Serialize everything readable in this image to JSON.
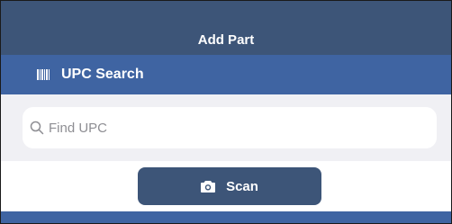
{
  "nav": {
    "title": "Add Part"
  },
  "section": {
    "label": "UPC Search",
    "icon": "barcode-icon"
  },
  "search": {
    "placeholder": "Find UPC",
    "value": "",
    "icon": "search-icon"
  },
  "scan": {
    "label": "Scan",
    "icon": "camera-icon"
  },
  "colors": {
    "nav_bar": "#3d5578",
    "section_header": "#3f64a2",
    "search_bg": "#f0f0f4",
    "button": "#3d5578",
    "text_light": "#ffffff",
    "placeholder": "#8e8e93"
  }
}
